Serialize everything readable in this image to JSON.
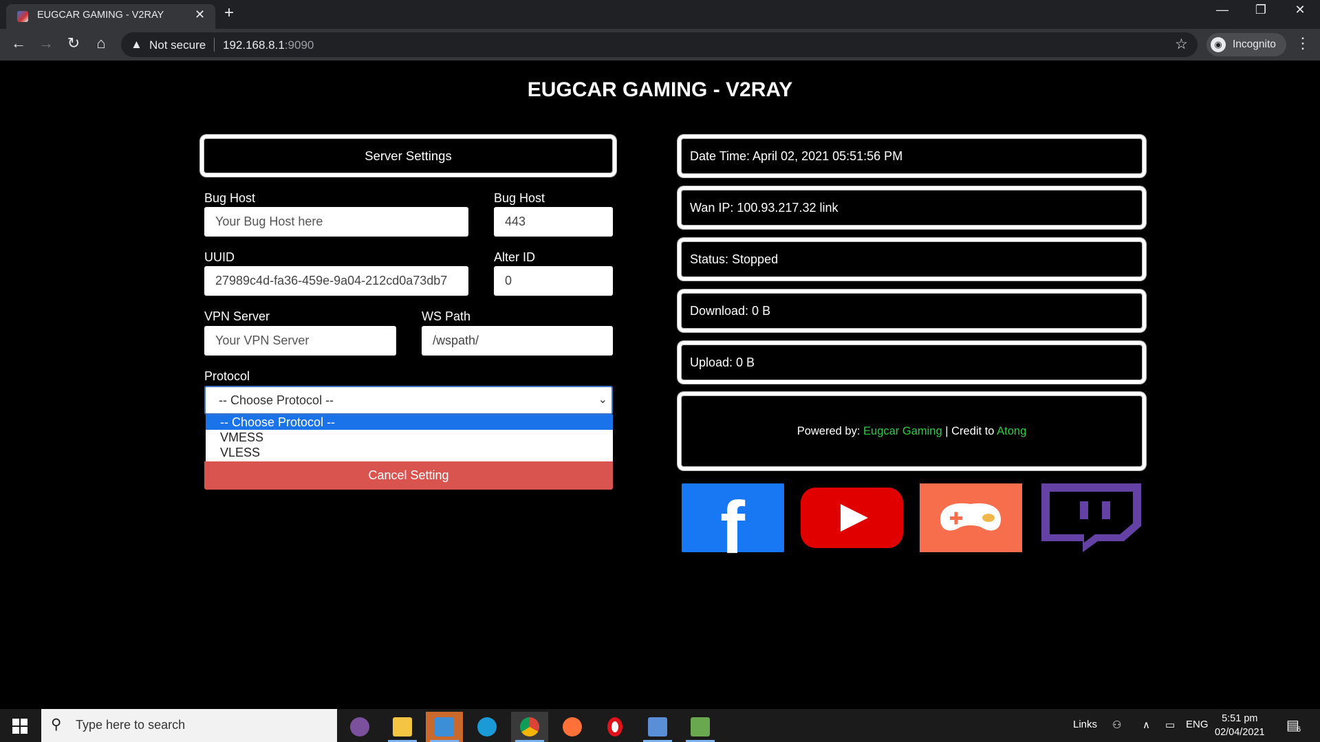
{
  "browser": {
    "tab_title": "EUGCAR GAMING - V2RAY",
    "security_label": "Not secure",
    "url_host": "192.168.8.1",
    "url_port": ":9090",
    "profile_label": "Incognito"
  },
  "page": {
    "title": "EUGCAR GAMING - V2RAY",
    "server_settings_label": "Server Settings",
    "form": {
      "bug_host_label": "Bug Host",
      "bug_host_placeholder": "Your Bug Host here",
      "bug_port_label": "Bug Host",
      "bug_port_value": "443",
      "uuid_label": "UUID",
      "uuid_value": "27989c4d-fa36-459e-9a04-212cd0a73db7",
      "alter_id_label": "Alter ID",
      "alter_id_value": "0",
      "vpn_server_label": "VPN Server",
      "vpn_server_placeholder": "Your VPN Server",
      "ws_path_label": "WS Path",
      "ws_path_value": "/wspath/",
      "protocol_label": "Protocol",
      "protocol_selected": "-- Choose Protocol --",
      "protocol_options": [
        "-- Choose Protocol --",
        "VMESS",
        "VLESS"
      ],
      "cancel_label": "Cancel Setting"
    },
    "info": {
      "datetime": "Date Time: April 02, 2021 05:51:56 PM",
      "wan_ip": "Wan IP: 100.93.217.32 link",
      "status": "Status: Stopped",
      "download": "Download: 0 B",
      "upload": "Upload: 0 B"
    },
    "credits": {
      "powered_prefix": "Powered by: ",
      "powered_name": "Eugcar Gaming",
      "credit_prefix": " | Credit to ",
      "credit_name": "Atong"
    },
    "social": [
      "facebook-icon",
      "youtube-icon",
      "game-controller-icon",
      "twitch-icon"
    ],
    "colors": {
      "accent_green": "#2ecc40",
      "cancel_red": "#d9534f",
      "select_highlight": "#1a73e8"
    }
  },
  "taskbar": {
    "search_placeholder": "Type here to search",
    "links_label": "Links",
    "lang": "ENG",
    "time": "5:51 pm",
    "date": "02/04/2021",
    "notification_count": "6"
  }
}
